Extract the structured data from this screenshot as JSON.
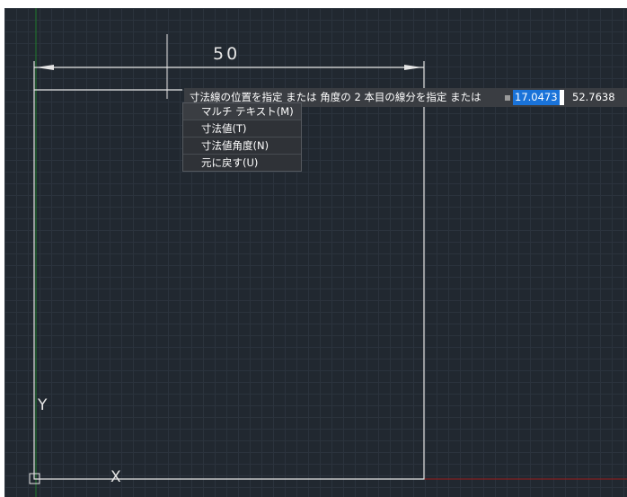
{
  "dimension": {
    "value_text": "50"
  },
  "axis": {
    "y_label": "Y",
    "x_label": "X"
  },
  "tooltip": {
    "prompt": "寸法線の位置を指定 または 角度の 2 本目の線分を指定 または",
    "x_value": "17.0473",
    "y_value": "52.7638"
  },
  "menu": {
    "items": [
      {
        "label": "マルチ テキスト(M)"
      },
      {
        "label": "寸法値(T)"
      },
      {
        "label": "寸法値角度(N)"
      },
      {
        "label": "元に戻す(U)"
      }
    ]
  },
  "colors": {
    "background": "#212830",
    "grid": "#2b333d",
    "geometry": "#e6e6e6",
    "highlight": "#1a73d9",
    "x_axis": "#9b1b1b",
    "y_axis": "#1f7a2b"
  }
}
